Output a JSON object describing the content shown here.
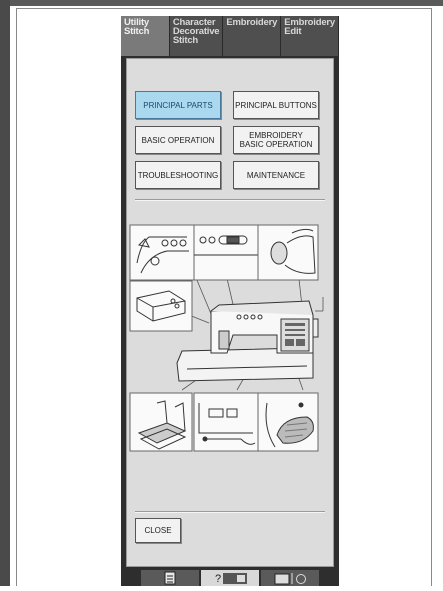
{
  "tabs": [
    {
      "lines": [
        "Utility",
        "Stitch"
      ],
      "active": true
    },
    {
      "lines": [
        "Character",
        "Decorative",
        "Stitch"
      ],
      "active": false
    },
    {
      "lines": [
        "Embroidery"
      ],
      "active": false
    },
    {
      "lines": [
        "Embroidery",
        "Edit"
      ],
      "active": false
    }
  ],
  "buttons": {
    "principal_parts": "PRINCIPAL PARTS",
    "principal_buttons": "PRINCIPAL BUTTONS",
    "basic_operation": "BASIC OPERATION",
    "embroidery_basic_operation_line1": "EMBROIDERY",
    "embroidery_basic_operation_line2": "BASIC OPERATION",
    "troubleshooting": "TROUBLESHOOTING",
    "maintenance": "MAINTENANCE",
    "close": "CLOSE"
  },
  "bottom_bar": {
    "icons": [
      "document-icon",
      "help-machine-icon",
      "machine-settings-icon"
    ]
  },
  "colors": {
    "selected_button": "#a9d8ef",
    "panel": "#dcdcdc",
    "screen_bezel": "#2e2e2e"
  }
}
